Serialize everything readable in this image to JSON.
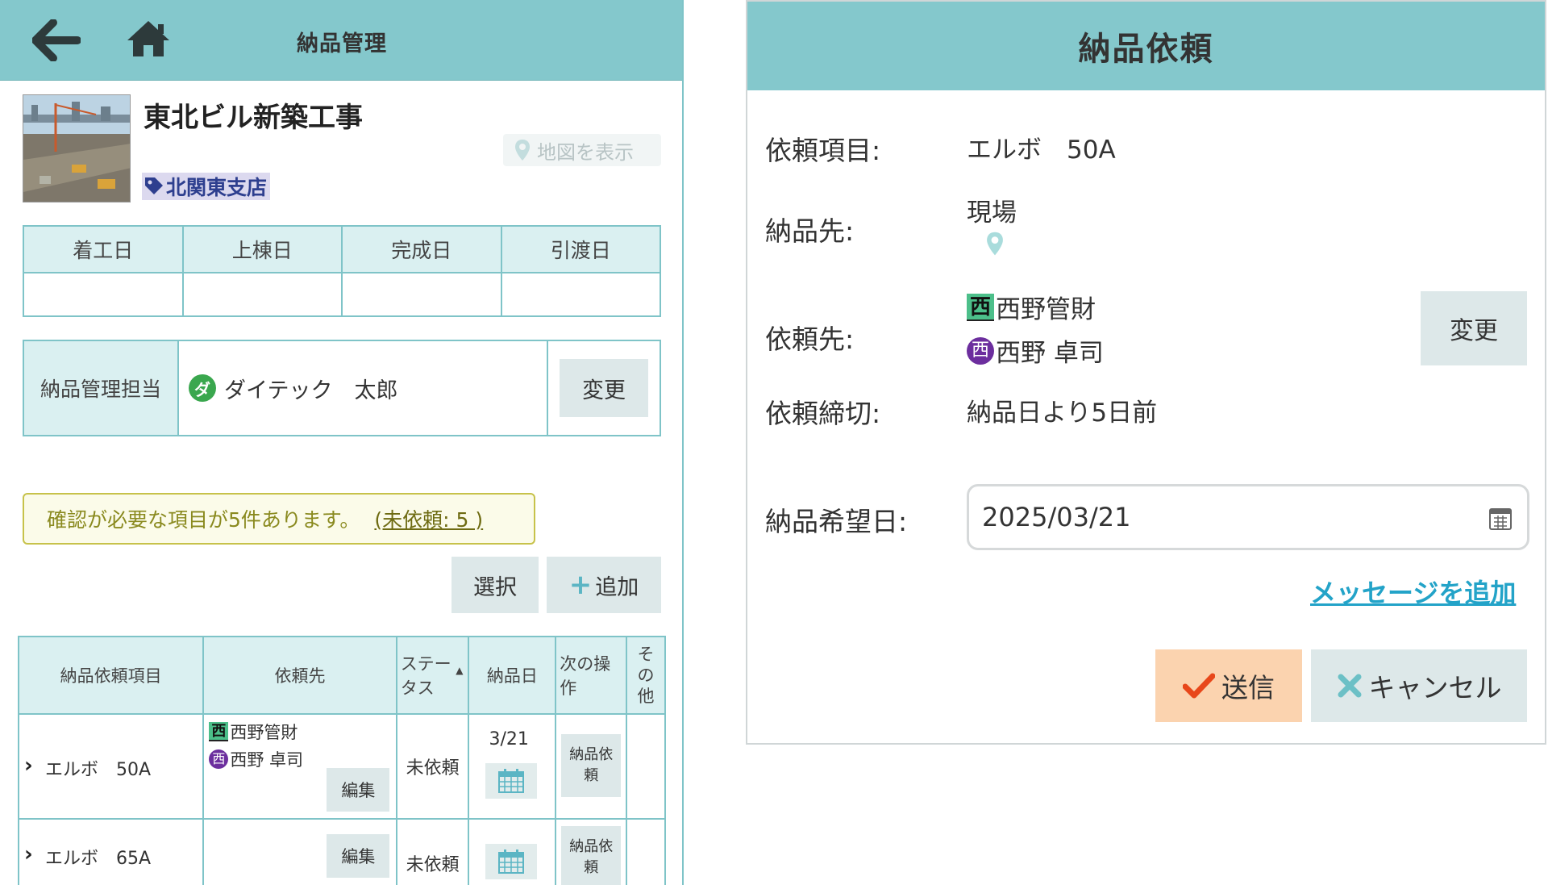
{
  "left": {
    "header": {
      "title": "納品管理",
      "back_icon": "back-arrow-icon",
      "home_icon": "home-icon"
    },
    "project": {
      "name": "東北ビル新築工事",
      "map_button": "地図を表示",
      "branch": "北関東支店"
    },
    "dates": {
      "headers": [
        "着工日",
        "上棟日",
        "完成日",
        "引渡日"
      ],
      "values": [
        "",
        "",
        "",
        ""
      ]
    },
    "manager": {
      "label": "納品管理担当",
      "avatar": "ダ",
      "name": "ダイテック　太郎",
      "change_button": "変更"
    },
    "alert": {
      "text": "確認が必要な項目が5件あります。",
      "link": "(未依頼: 5 )"
    },
    "actions": {
      "select": "選択",
      "add": "追加"
    },
    "table": {
      "headers": {
        "item": "納品依頼項目",
        "vendor": "依頼先",
        "status_line1": "ステー",
        "status_line2": "タス",
        "date": "納品日",
        "next_line1": "次の操",
        "next_line2": "作",
        "other_line1": "そ",
        "other_line2": "の",
        "other_line3": "他"
      },
      "rows": [
        {
          "item": "エルボ　50A",
          "vendor_company_badge": "西",
          "vendor_company": "西野管財",
          "vendor_person_badge": "西",
          "vendor_person": "西野 卓司",
          "edit": "編集",
          "status": "未依頼",
          "date": "3/21",
          "next_line1": "納品依",
          "next_line2": "頼"
        },
        {
          "item": "エルボ　65A",
          "edit": "編集",
          "status": "未依頼",
          "date": "",
          "next_line1": "納品依",
          "next_line2": "頼"
        }
      ]
    }
  },
  "right": {
    "title": "納品依頼",
    "fields": {
      "item_label": "依頼項目:",
      "item_value": "エルボ　50A",
      "dest_label": "納品先:",
      "dest_value": "現場",
      "vendor_label": "依頼先:",
      "vendor_company_badge": "西",
      "vendor_company": "西野管財",
      "vendor_person_badge": "西",
      "vendor_person": "西野 卓司",
      "change_button": "変更",
      "deadline_label": "依頼締切:",
      "deadline_value": "納品日より5日前",
      "date_label": "納品希望日:",
      "date_value": "2025/03/21"
    },
    "message_link": "メッセージを追加",
    "send_button": "送信",
    "cancel_button": "キャンセル"
  },
  "colors": {
    "header": "#84c8cc",
    "table_border": "#7fc4c8",
    "table_head": "#daf0f1",
    "alert_border": "#c7c24a",
    "status_red": "#e0242f",
    "link": "#23a3c8",
    "send_bg": "#fbd3af"
  }
}
